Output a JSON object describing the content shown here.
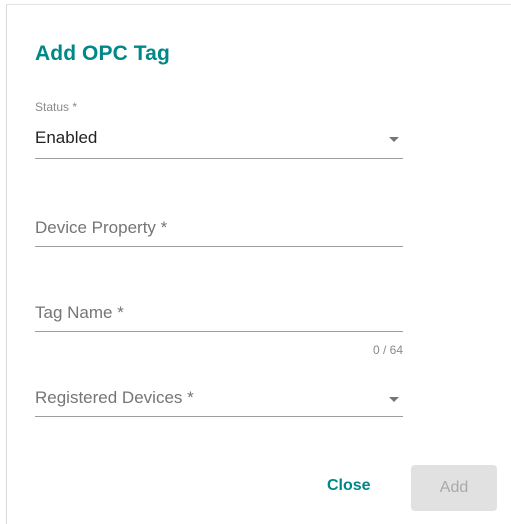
{
  "dialog": {
    "title": "Add OPC Tag"
  },
  "fields": {
    "status": {
      "label": "Status *",
      "value": "Enabled"
    },
    "device_property": {
      "placeholder": "Device Property *"
    },
    "tag_name": {
      "placeholder": "Tag Name *",
      "counter": "0 / 64"
    },
    "registered_devices": {
      "placeholder": "Registered Devices *"
    }
  },
  "actions": {
    "close_label": "Close",
    "add_label": "Add",
    "add_enabled": false
  },
  "colors": {
    "accent": "#008787",
    "disabled_bg": "#e1e1e1",
    "disabled_text": "#a9a9a9"
  },
  "icons": {
    "dropdown": "chevron-down-icon"
  }
}
